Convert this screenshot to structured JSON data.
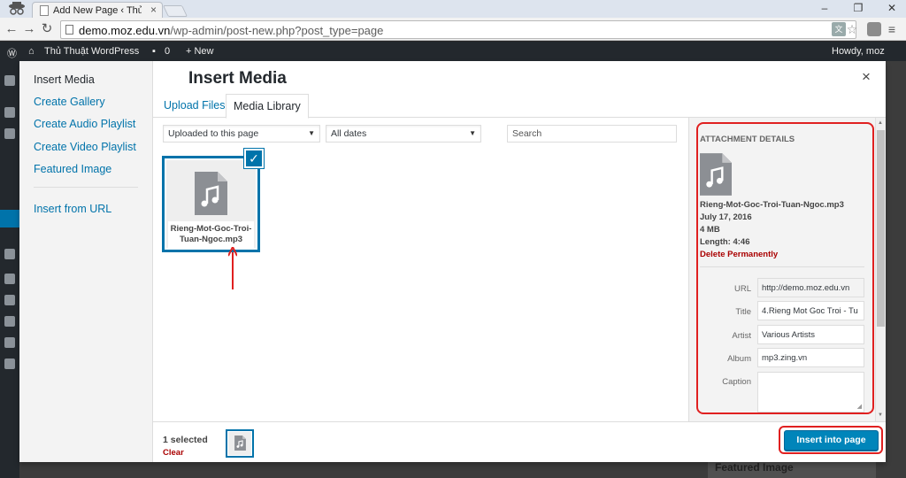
{
  "browser": {
    "tab_title": "Add New Page ‹ Thủ Thuậ",
    "tab_close": "×",
    "url_host": "demo.moz.edu.vn",
    "url_path": "/wp-admin/post-new.php?post_type=page",
    "window_buttons": [
      "–",
      "❐",
      "✕"
    ]
  },
  "admin_bar": {
    "site_name": "Thủ Thuật WordPress",
    "comments": "0",
    "new_label": "+ New",
    "howdy": "Howdy, moz"
  },
  "background": {
    "featured_image_heading": "Featured Image"
  },
  "modal": {
    "menu": {
      "insert_media": "Insert Media",
      "create_gallery": "Create Gallery",
      "create_audio_playlist": "Create Audio Playlist",
      "create_video_playlist": "Create Video Playlist",
      "featured_image": "Featured Image",
      "insert_from_url": "Insert from URL"
    },
    "title": "Insert Media",
    "close_glyph": "×",
    "tabs": {
      "upload": "Upload Files",
      "library": "Media Library"
    },
    "filters": {
      "attachment_filter": "Uploaded to this page",
      "date_filter": "All dates",
      "search_placeholder": "Search"
    },
    "attachment": {
      "filename": "Rieng-Mot-Goc-Troi-Tuan-Ngoc.mp3",
      "check_glyph": "✓"
    },
    "details": {
      "heading": "Attachment Details",
      "filename": "Rieng-Mot-Goc-Troi-Tuan-Ngoc.mp3",
      "date": "July 17, 2016",
      "size": "4 MB",
      "length": "Length: 4:46",
      "delete": "Delete Permanently",
      "labels": {
        "url": "URL",
        "title": "Title",
        "artist": "Artist",
        "album": "Album",
        "caption": "Caption"
      },
      "values": {
        "url": "http://demo.moz.edu.vn",
        "title": "4.Rieng Mot Goc Troi - Tu",
        "artist": "Various Artists",
        "album": "mp3.zing.vn",
        "caption": ""
      }
    },
    "toolbar": {
      "selected": "1 selected",
      "clear": "Clear",
      "insert_button": "Insert into page"
    }
  },
  "colors": {
    "accent": "#0073aa",
    "button": "#0085ba",
    "delete": "#a00000",
    "annotation": "#e02020"
  }
}
